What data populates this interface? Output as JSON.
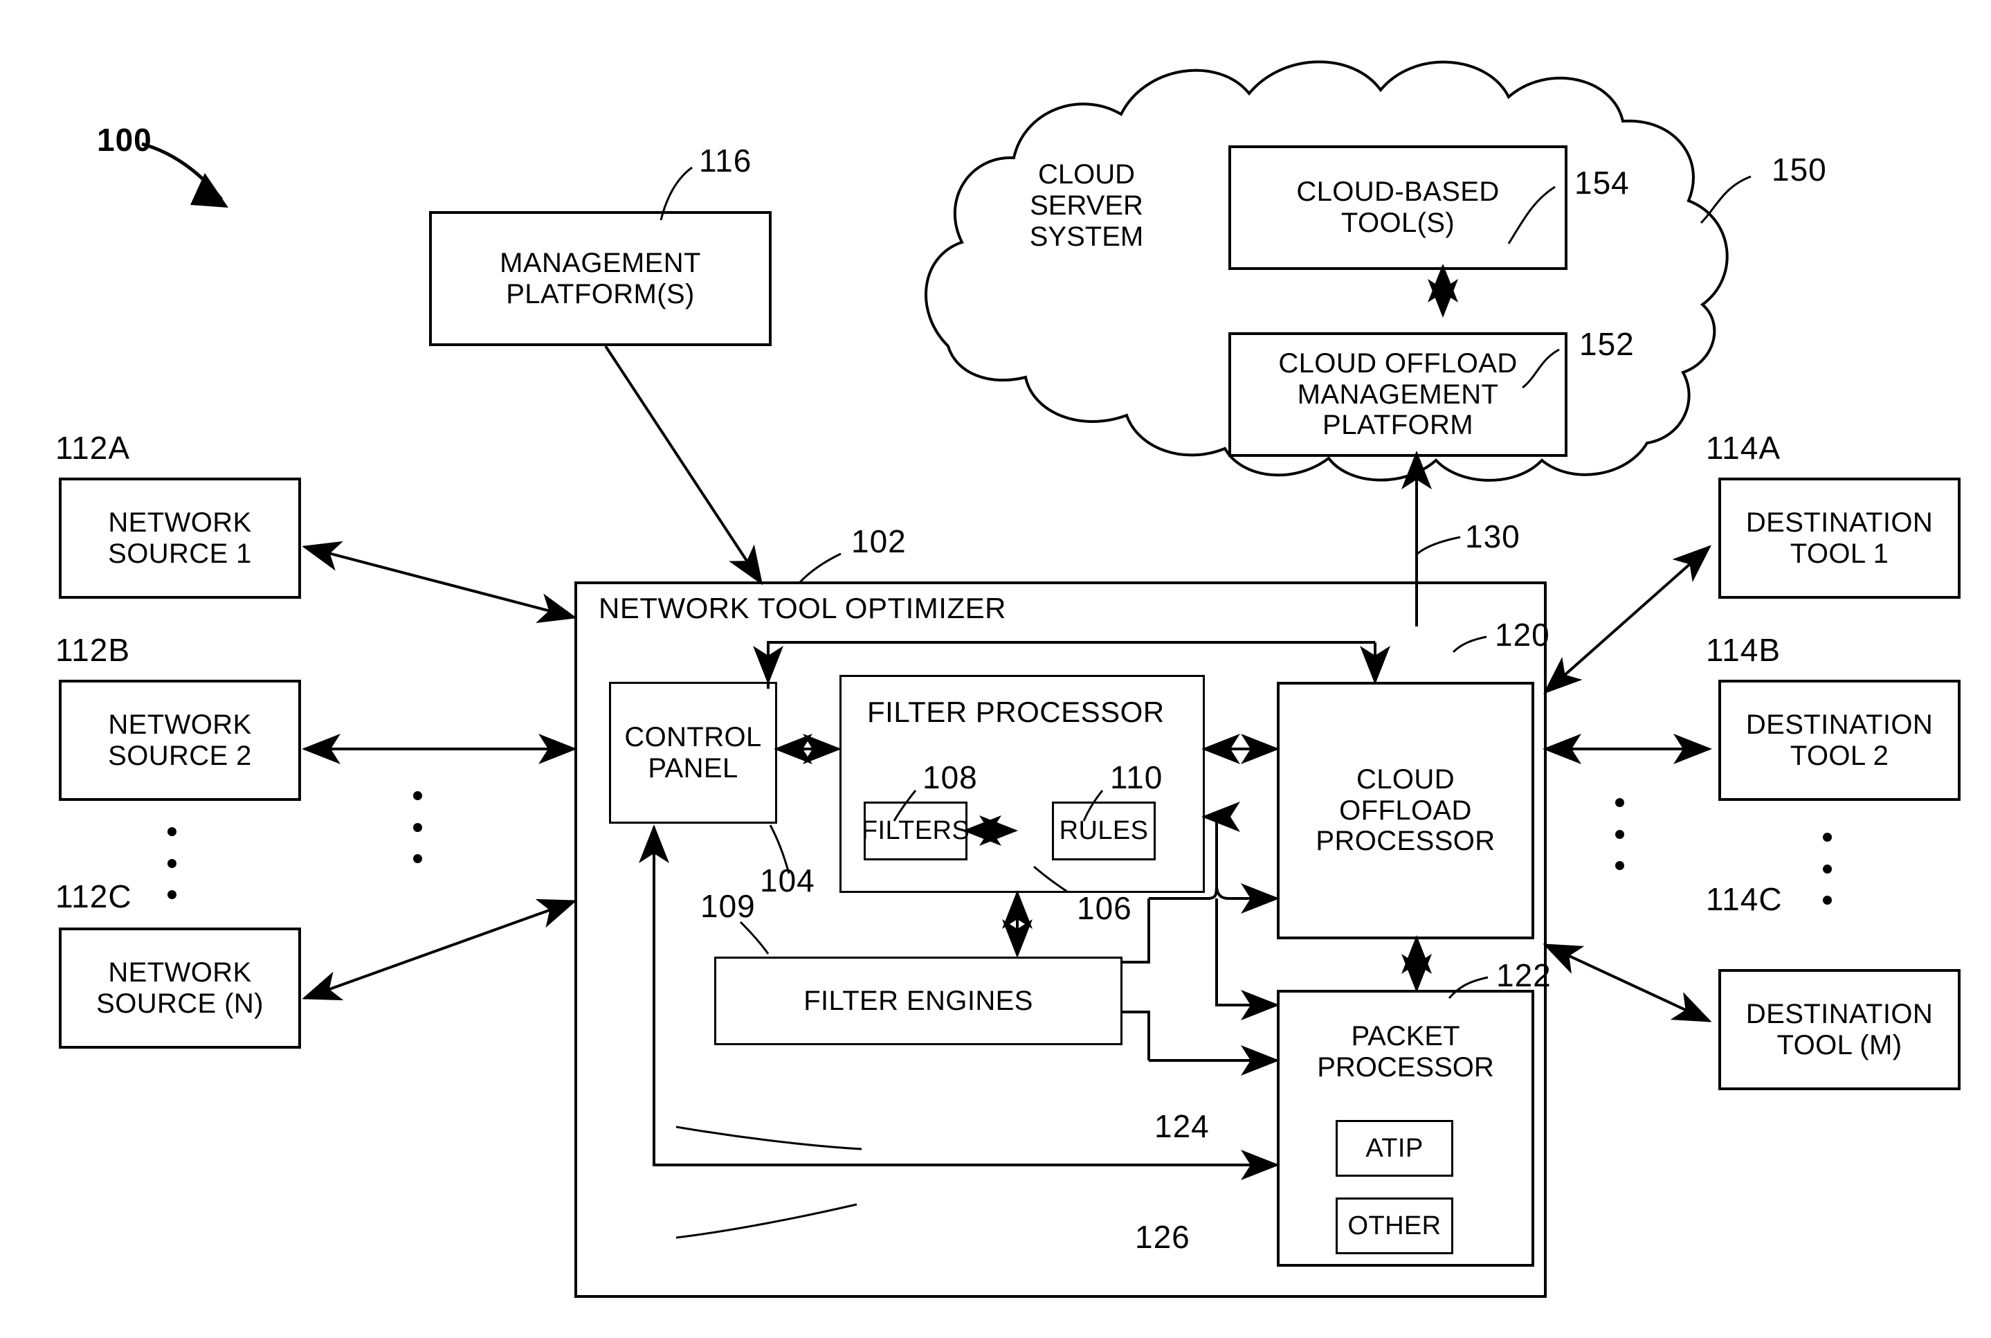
{
  "figure": {
    "figure_ref": "100"
  },
  "nodes": {
    "management_platform": {
      "label": "MANAGEMENT\nPLATFORM(S)",
      "ref": "116"
    },
    "cloud_server_system": {
      "label": "CLOUD\nSERVER\nSYSTEM",
      "ref": "150"
    },
    "cloud_based_tools": {
      "label": "CLOUD-BASED\nTOOL(S)",
      "ref": "154"
    },
    "cloud_offload_management_platform": {
      "label": "CLOUD OFFLOAD\nMANAGEMENT\nPLATFORM",
      "ref": "152"
    },
    "network_tool_optimizer": {
      "label": "NETWORK TOOL OPTIMIZER",
      "ref": "102"
    },
    "control_panel": {
      "label": "CONTROL\nPANEL",
      "ref": "104"
    },
    "filter_processor": {
      "label": "FILTER PROCESSOR",
      "ref": "106"
    },
    "filters": {
      "label": "FILTERS",
      "ref": "108"
    },
    "rules": {
      "label": "RULES",
      "ref": "110"
    },
    "filter_engines": {
      "label": "FILTER ENGINES",
      "ref": "109"
    },
    "cloud_offload_processor": {
      "label": "CLOUD\nOFFLOAD\nPROCESSOR",
      "ref": "120"
    },
    "packet_processor": {
      "label": "PACKET\nPROCESSOR",
      "ref": "122"
    },
    "atip": {
      "label": "ATIP",
      "ref": "124"
    },
    "other": {
      "label": "OTHER",
      "ref": "126"
    },
    "network_source_1": {
      "label": "NETWORK\nSOURCE 1",
      "ref": "112A"
    },
    "network_source_2": {
      "label": "NETWORK\nSOURCE 2",
      "ref": "112B"
    },
    "network_source_n": {
      "label": "NETWORK\nSOURCE (N)",
      "ref": "112C"
    },
    "destination_tool_1": {
      "label": "DESTINATION\nTOOL 1",
      "ref": "114A"
    },
    "destination_tool_2": {
      "label": "DESTINATION\nTOOL 2",
      "ref": "114B"
    },
    "destination_tool_m": {
      "label": "DESTINATION\nTOOL (M)",
      "ref": "114C"
    }
  },
  "connections": {
    "cloud_link": {
      "ref": "130"
    }
  }
}
